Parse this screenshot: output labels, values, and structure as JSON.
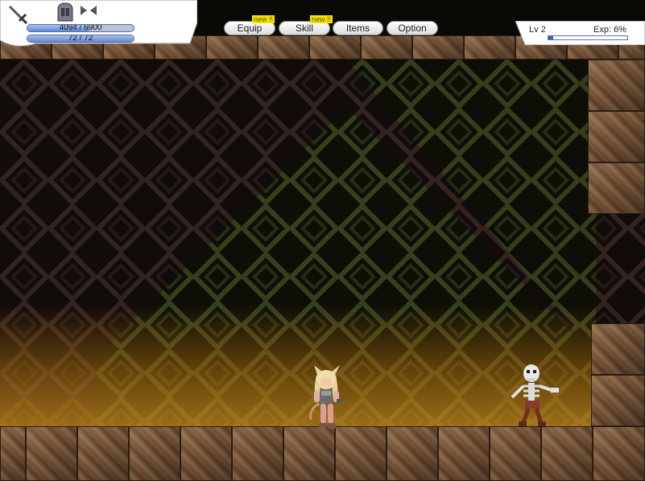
{
  "hud": {
    "hp": {
      "current": 4094,
      "max": 6900,
      "text": "4094 / 6900",
      "fraction": 0.593
    },
    "sp": {
      "current": 72,
      "max": 72,
      "text": "72 / 72",
      "fraction": 1.0
    },
    "equipped_icons": [
      "sword-icon",
      "helmet-icon",
      "bow-icon"
    ]
  },
  "menu": {
    "buttons": [
      {
        "label": "Equip",
        "badge": "new !!"
      },
      {
        "label": "Skill",
        "badge": "new !!"
      },
      {
        "label": "Items",
        "badge": ""
      },
      {
        "label": "Option",
        "badge": ""
      }
    ]
  },
  "status": {
    "level_text": "Lv 2",
    "exp_text": "Exp: 6%",
    "exp_fraction": 0.06
  },
  "scene": {
    "player": "cat-eared-warrior-girl",
    "enemy": "skeleton",
    "colors": {
      "stone": "#7a5a3c",
      "glow": "#c88c1e",
      "pattern": "#4a5a2a"
    }
  }
}
